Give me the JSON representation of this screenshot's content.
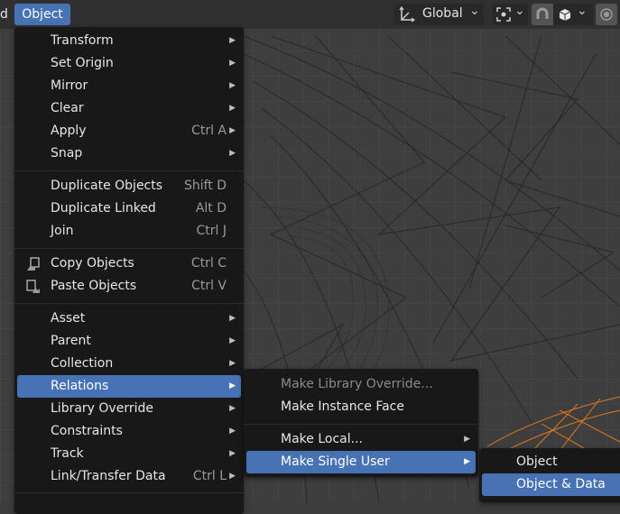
{
  "header": {
    "left_fragment": "d",
    "menu_object_label": "Object",
    "orientation_label": "Global"
  },
  "main_menu": {
    "items": [
      {
        "label": "Transform",
        "shortcut": "",
        "submenu": true
      },
      {
        "label": "Set Origin",
        "shortcut": "",
        "submenu": true
      },
      {
        "label": "Mirror",
        "shortcut": "",
        "submenu": true
      },
      {
        "label": "Clear",
        "shortcut": "",
        "submenu": true
      },
      {
        "label": "Apply",
        "shortcut": "Ctrl A",
        "submenu": true
      },
      {
        "label": "Snap",
        "shortcut": "",
        "submenu": true
      },
      {
        "label": "Duplicate Objects",
        "shortcut": "Shift D",
        "submenu": false
      },
      {
        "label": "Duplicate Linked",
        "shortcut": "Alt D",
        "submenu": false
      },
      {
        "label": "Join",
        "shortcut": "Ctrl J",
        "submenu": false
      },
      {
        "label": "Copy Objects",
        "shortcut": "Ctrl C",
        "submenu": false
      },
      {
        "label": "Paste Objects",
        "shortcut": "Ctrl V",
        "submenu": false
      },
      {
        "label": "Asset",
        "shortcut": "",
        "submenu": true
      },
      {
        "label": "Parent",
        "shortcut": "",
        "submenu": true
      },
      {
        "label": "Collection",
        "shortcut": "",
        "submenu": true
      },
      {
        "label": "Relations",
        "shortcut": "",
        "submenu": true
      },
      {
        "label": "Library Override",
        "shortcut": "",
        "submenu": true
      },
      {
        "label": "Constraints",
        "shortcut": "",
        "submenu": true
      },
      {
        "label": "Track",
        "shortcut": "",
        "submenu": true
      },
      {
        "label": "Link/Transfer Data",
        "shortcut": "Ctrl L",
        "submenu": true
      }
    ]
  },
  "relations_menu": {
    "items": [
      {
        "label": "Make Library Override...",
        "submenu": false
      },
      {
        "label": "Make Instance Face",
        "submenu": false
      },
      {
        "label": "Make Local...",
        "submenu": true
      },
      {
        "label": "Make Single User",
        "submenu": true
      }
    ]
  },
  "single_user_menu": {
    "items": [
      {
        "label": "Object"
      },
      {
        "label": "Object & Data"
      }
    ]
  },
  "icons": {
    "submenu_arrow": "▶",
    "dropdown": "⌄"
  },
  "colors": {
    "highlight": "#4772b3",
    "menu_bg": "#181818",
    "viewport_bg": "#3e3e3e",
    "selected_wire": "#e0781e"
  }
}
